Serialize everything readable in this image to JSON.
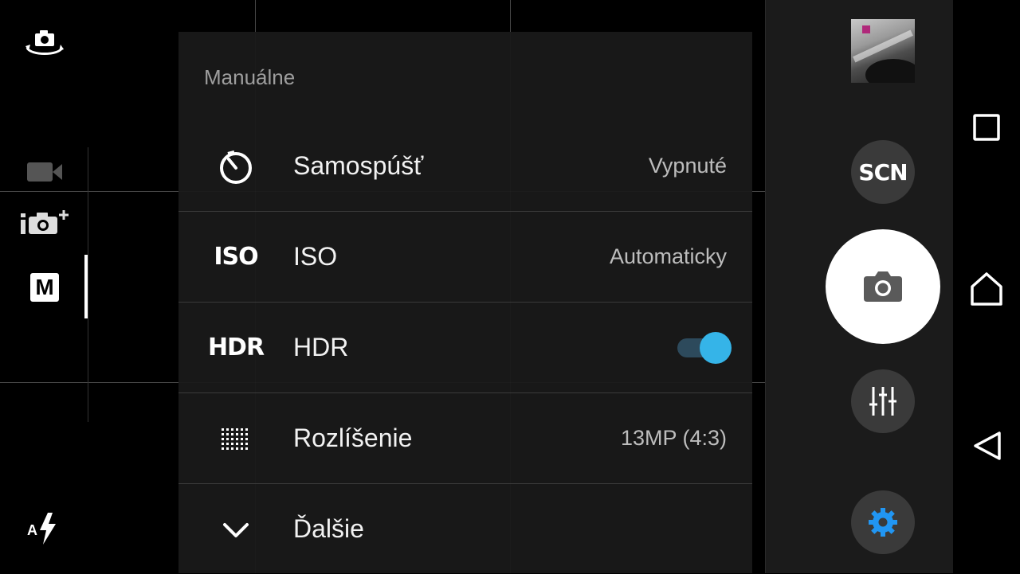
{
  "left_rail": {
    "switch_camera_icon": "camera-switch-icon",
    "video_mode_icon": "video-camera-icon",
    "superior_auto_icon": "intelligent-auto-icon",
    "manual_mode_label": "M",
    "flash_icon": "auto-flash-icon",
    "flash_letter": "A"
  },
  "settings_panel": {
    "title": "Manuálne",
    "rows": [
      {
        "icon": "self-timer-icon",
        "label": "Samospúšť",
        "value": "Vypnuté"
      },
      {
        "icon": "iso-icon",
        "icon_text": "ISO",
        "label": "ISO",
        "value": "Automaticky"
      },
      {
        "icon": "hdr-icon",
        "icon_text": "HDR",
        "label": "HDR",
        "toggle": true
      },
      {
        "icon": "resolution-icon",
        "label": "Rozlíšenie",
        "value": "13MP (4:3)"
      },
      {
        "icon": "chevron-down-icon",
        "label": "Ďalšie"
      }
    ]
  },
  "right_bar": {
    "scn_label": "SCN",
    "shutter_icon": "camera-icon",
    "manual_settings_icon": "sliders-icon",
    "settings_icon": "gear-icon"
  },
  "colors": {
    "accent": "#35b4e8",
    "toggle_track": "#2d4a5c",
    "panel": "#1a1a1a",
    "button": "#3a3a3a",
    "gear": "#2196f3"
  },
  "nav": {
    "recents_icon": "square-icon",
    "home_icon": "home-icon",
    "back_icon": "back-triangle-icon"
  }
}
